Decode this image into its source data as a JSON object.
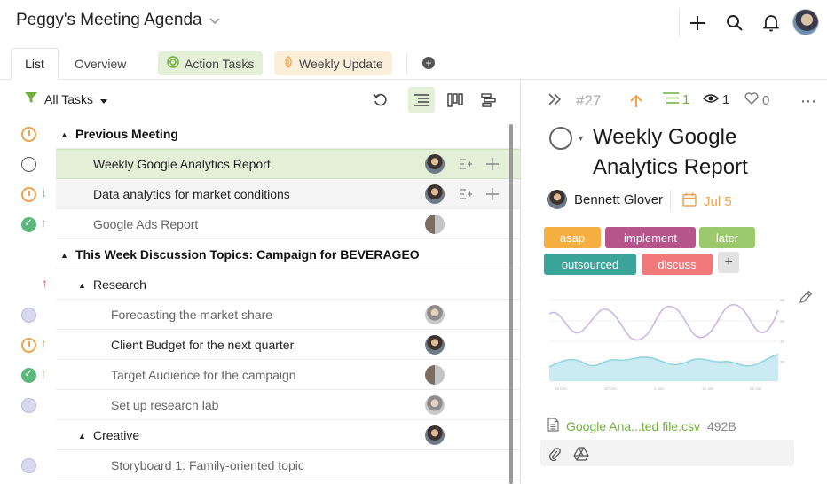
{
  "header": {
    "title": "Peggy's Meeting Agenda"
  },
  "tabs": [
    {
      "label": "List"
    },
    {
      "label": "Overview"
    },
    {
      "label": "Action Tasks"
    },
    {
      "label": "Weekly Update"
    }
  ],
  "toolbar": {
    "filter_label": "All Tasks"
  },
  "list": {
    "rows": [
      {
        "text": "Previous Meeting"
      },
      {
        "text": "Weekly Google Analytics Report"
      },
      {
        "text": "Data analytics for market conditions"
      },
      {
        "text": "Google Ads Report"
      },
      {
        "text": "This Week Discussion Topics: Campaign for BEVERAGEO"
      },
      {
        "text": "Research"
      },
      {
        "text": "Forecasting the market share"
      },
      {
        "text": "Client Budget for the next quarter"
      },
      {
        "text": "Target Audience for the campaign"
      },
      {
        "text": "Set up research lab"
      },
      {
        "text": "Creative"
      },
      {
        "text": "Storyboard 1: Family-oriented topic"
      }
    ]
  },
  "detail": {
    "number": "#27",
    "subtasks_count": "1",
    "watchers_count": "1",
    "likes_count": "0",
    "title": "Weekly Google Analytics Report",
    "assignee": "Bennett Glover",
    "due_date": "Jul 5",
    "tags": [
      {
        "label": "asap",
        "color": "#f5b041"
      },
      {
        "label": "implement",
        "color": "#b5558c"
      },
      {
        "label": "later",
        "color": "#9cc96b"
      },
      {
        "label": "outsourced",
        "color": "#3aa39a"
      },
      {
        "label": "discuss",
        "color": "#f07a7a"
      }
    ],
    "attachment": {
      "name": "Google Ana...ted file.csv",
      "size": "492B"
    }
  },
  "colors": {
    "accent_green": "#6fb03a",
    "selected_row": "#e3f0d7",
    "priority_up": "#f0a34a",
    "priority_down": "#5aa0d8",
    "priority_high": "#e05555"
  }
}
